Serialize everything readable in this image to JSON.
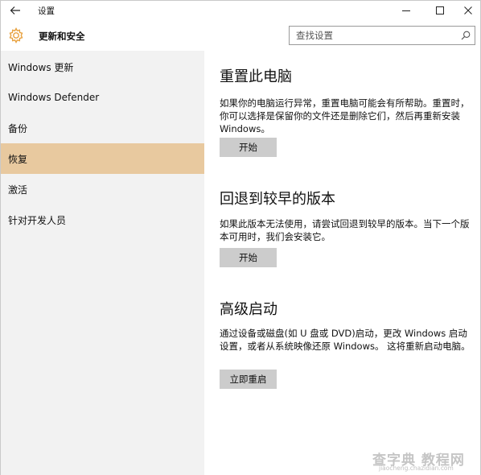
{
  "window": {
    "title": "设置"
  },
  "header": {
    "section_title": "更新和安全",
    "search_placeholder": "查找设置"
  },
  "sidebar": {
    "items": [
      {
        "label": "Windows 更新"
      },
      {
        "label": "Windows Defender"
      },
      {
        "label": "备份"
      },
      {
        "label": "恢复"
      },
      {
        "label": "激活"
      },
      {
        "label": "针对开发人员"
      }
    ],
    "selected": "恢复"
  },
  "content": {
    "sections": [
      {
        "title": "重置此电脑",
        "description": "如果你的电脑运行异常，重置电脑可能会有所帮助。重置时，你可以选择是保留你的文件还是删除它们，然后再重新安装 Windows。",
        "button_label": "开始"
      },
      {
        "title": "回退到较早的版本",
        "description": "如果此版本无法使用，请尝试回退到较早的版本。当下一个版本可用时，我们会安装它。",
        "button_label": "开始"
      },
      {
        "title": "高级启动",
        "description": "通过设备或磁盘(如 U 盘或 DVD)启动，更改 Windows 启动设置，或者从系统映像还原 Windows。 这将重新启动电脑。",
        "button_label": "立即重启"
      }
    ]
  },
  "watermark": {
    "text": "查字典 教程网",
    "url": "jiaocheng.chazidian.com"
  },
  "colors": {
    "accent": "#e8c99f",
    "sidebar_bg": "#f2f2f2",
    "button_bg": "#cccccc",
    "gear": "#e8a240"
  },
  "icons": [
    "back-arrow-icon",
    "minimize-icon",
    "maximize-icon",
    "close-icon",
    "gear-icon",
    "search-icon"
  ]
}
